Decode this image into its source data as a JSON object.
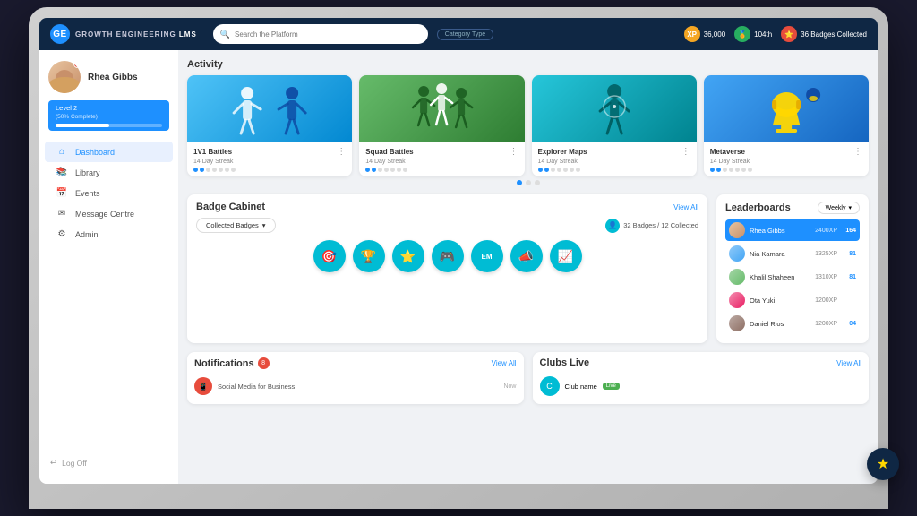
{
  "app": {
    "name": "GROWTH ENGINEERING",
    "name_bold": "LMS"
  },
  "search": {
    "placeholder": "Search the Platform"
  },
  "category": {
    "label": "Category Type"
  },
  "stats": {
    "xp": "36,000",
    "xp_label": "XP",
    "rank": "104th",
    "badges": "36 Badges Collected"
  },
  "user": {
    "name": "Rhea Gibbs",
    "level": "Level 2",
    "level_sub": "(50% Complete)",
    "notif_count": "2"
  },
  "nav": {
    "items": [
      {
        "id": "dashboard",
        "label": "Dashboard",
        "icon": "⌂",
        "active": true
      },
      {
        "id": "library",
        "label": "Library",
        "icon": "📚",
        "active": false
      },
      {
        "id": "events",
        "label": "Events",
        "icon": "📅",
        "active": false
      },
      {
        "id": "message-centre",
        "label": "Message Centre",
        "icon": "✉",
        "active": false
      },
      {
        "id": "admin",
        "label": "Admin",
        "icon": "⚙",
        "active": false
      }
    ],
    "logout": "Log Off"
  },
  "activity": {
    "title": "Activity",
    "cards": [
      {
        "id": "1v1-battles",
        "title": "1V1 Battles",
        "streak": "14 Day Streak",
        "color": "#4fc3f7",
        "thumb_type": "fighters"
      },
      {
        "id": "squad-battles",
        "title": "Squad Battles",
        "streak": "14 Day Streak",
        "color": "#66bb6a",
        "thumb_type": "group"
      },
      {
        "id": "explorer-maps",
        "title": "Explorer Maps",
        "streak": "14 Day Streak",
        "color": "#26c6da",
        "thumb_type": "explorer"
      },
      {
        "id": "metaverse",
        "title": "Metaverse",
        "streak": "14 Day Streak",
        "color": "#42a5f5",
        "thumb_type": "trophy"
      }
    ]
  },
  "badge_cabinet": {
    "title": "Badge Cabinet",
    "view_all": "View All",
    "dropdown_label": "Collected Badges",
    "count_label": "32 Badges / 12 Collected",
    "badges": [
      {
        "icon": "🎯",
        "id": "badge-1"
      },
      {
        "icon": "🏆",
        "id": "badge-2"
      },
      {
        "icon": "⭐",
        "id": "badge-3"
      },
      {
        "icon": "🎮",
        "id": "badge-4"
      },
      {
        "icon": "EM",
        "id": "badge-5"
      },
      {
        "icon": "📣",
        "id": "badge-6"
      },
      {
        "icon": "📈",
        "id": "badge-7"
      }
    ]
  },
  "leaderboard": {
    "title": "Leaderboards",
    "period": "Weekly",
    "entries": [
      {
        "name": "Rhea Gibbs",
        "xp": "2400XP",
        "rank": "164",
        "highlighted": true,
        "avatar_class": "lb-avatar-1"
      },
      {
        "name": "Nia Kamara",
        "xp": "1325XP",
        "rank": "81",
        "highlighted": false,
        "avatar_class": "lb-avatar-2"
      },
      {
        "name": "Khalil Shaheen",
        "xp": "1310XP",
        "rank": "81",
        "highlighted": false,
        "avatar_class": "lb-avatar-3"
      },
      {
        "name": "Ota Yuki",
        "xp": "1200XP",
        "rank": "",
        "highlighted": false,
        "avatar_class": "lb-avatar-4"
      },
      {
        "name": "Daniel Rios",
        "xp": "1200XP",
        "rank": "04",
        "highlighted": false,
        "avatar_class": "lb-avatar-5"
      }
    ]
  },
  "notifications": {
    "title": "Notifications",
    "count": "8",
    "view_all": "View All",
    "items": [
      {
        "text": "Social Media for Business",
        "time": "Now"
      }
    ]
  },
  "clubs": {
    "title": "Clubs Live",
    "view_all": "View All",
    "items": [
      {
        "text": "Club name",
        "status": "Live"
      }
    ]
  }
}
